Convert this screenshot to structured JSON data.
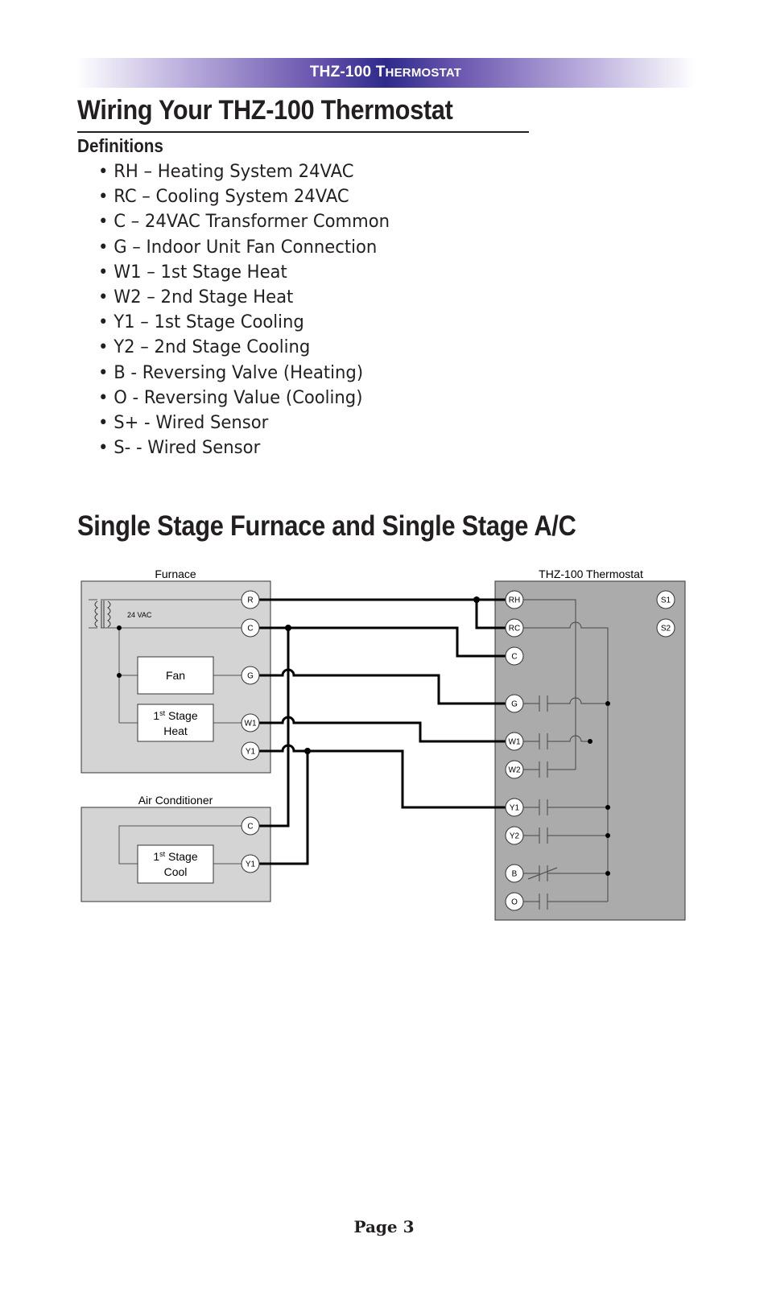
{
  "header": {
    "product": "THZ-100",
    "product_word": "Thermostat"
  },
  "title": "Wiring Your THZ-100 Thermostat",
  "definitions": {
    "heading": "Definitions",
    "items": [
      "RH – Heating System 24VAC",
      "RC – Cooling System 24VAC",
      "C – 24VAC Transformer Common",
      "G – Indoor Unit Fan Connection",
      "W1 – 1st Stage Heat",
      "W2 – 2nd Stage Heat",
      "Y1 – 1st Stage Cooling",
      "Y2 – 2nd Stage Cooling",
      "B - Reversing Valve (Heating)",
      "O - Reversing Value (Cooling)",
      "S+ - Wired Sensor",
      "S- - Wired Sensor"
    ]
  },
  "section_title": "Single Stage Furnace and Single Stage A/C",
  "diagram": {
    "furnace": {
      "label": "Furnace",
      "transformer_label": "24 VAC",
      "fan_label": "Fan",
      "heat_label_num": "1",
      "heat_label_sup": "st",
      "heat_label_rest": " Stage",
      "heat_label_line2": "Heat",
      "terminals": [
        "R",
        "C",
        "G",
        "W1",
        "Y1"
      ]
    },
    "air_conditioner": {
      "label": "Air Conditioner",
      "cool_label_num": "1",
      "cool_label_sup": "st",
      "cool_label_rest": " Stage",
      "cool_label_line2": "Cool",
      "terminals": [
        "C",
        "Y1"
      ]
    },
    "thermostat": {
      "label": "THZ-100 Thermostat",
      "terminals": [
        "RH",
        "RC",
        "C",
        "G",
        "W1",
        "W2",
        "Y1",
        "Y2",
        "B",
        "O"
      ],
      "sensor_terminals": [
        "S1",
        "S2"
      ]
    },
    "colors": {
      "furnace_fill": "#d4d4d4",
      "thermostat_fill": "#ababab",
      "wire": "#000000"
    }
  },
  "footer": {
    "page": "Page 3"
  }
}
